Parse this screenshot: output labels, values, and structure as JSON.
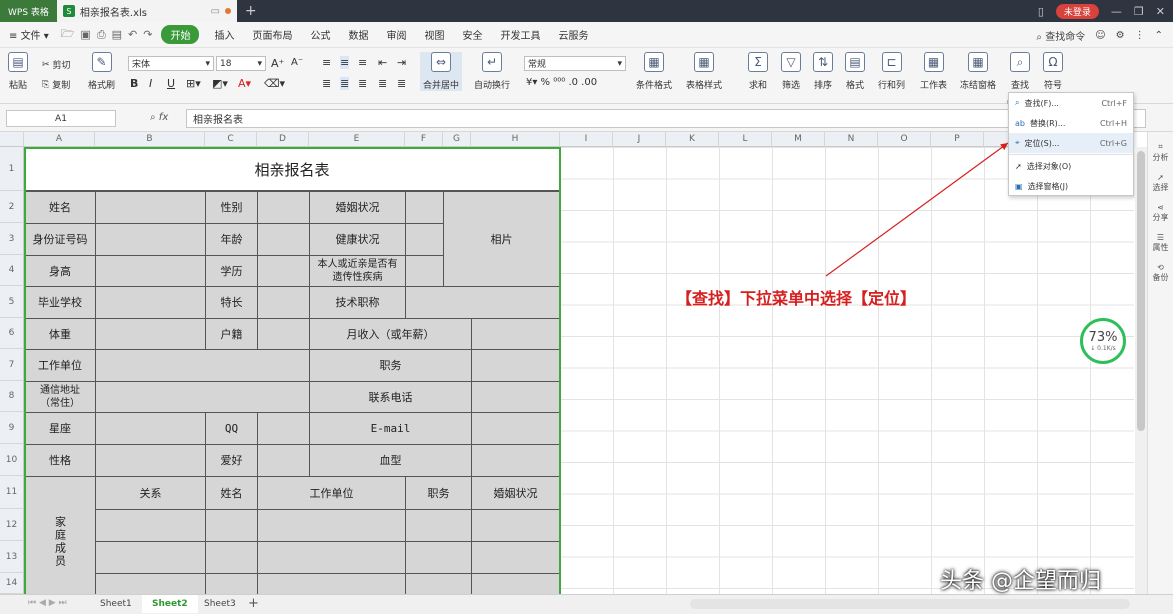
{
  "titlebar": {
    "app": "WPS 表格",
    "doc_tab": "相亲报名表.xls",
    "login": "未登录"
  },
  "menubar": {
    "items": [
      "文件",
      "开始",
      "插入",
      "页面布局",
      "公式",
      "数据",
      "审阅",
      "视图",
      "安全",
      "开发工具",
      "云服务"
    ],
    "search": "查找命令"
  },
  "ribbon": {
    "paste": "粘贴",
    "cut": "剪切",
    "copy": "复制",
    "format_painter": "格式刷",
    "font_name": "宋体",
    "font_size": "18",
    "merge_center": "合并居中",
    "wrap": "自动换行",
    "number_format": "常规",
    "cond_format": "条件格式",
    "table_style": "表格样式",
    "sum": "求和",
    "filter": "筛选",
    "sort": "排序",
    "format": "格式",
    "row_col": "行和列",
    "sheet": "工作表",
    "freeze": "冻结窗格",
    "find": "查找",
    "symbol": "符号"
  },
  "formulabar": {
    "cell": "A1",
    "fx": "fx",
    "value": "相亲报名表"
  },
  "columns": [
    "A",
    "B",
    "C",
    "D",
    "E",
    "F",
    "G",
    "H",
    "I",
    "J",
    "K",
    "L",
    "M",
    "N",
    "O",
    "P"
  ],
  "rows": [
    "1",
    "2",
    "3",
    "4",
    "5",
    "6",
    "7",
    "8",
    "9",
    "10",
    "11",
    "12",
    "13",
    "14"
  ],
  "table": {
    "title": "相亲报名表",
    "r2": [
      "姓名",
      "性别",
      "婚姻状况",
      "相片"
    ],
    "r3": [
      "身份证号码",
      "年龄",
      "健康状况"
    ],
    "r4": [
      "身高",
      "学历",
      "本人或近亲是否有遗传性疾病"
    ],
    "r5": [
      "毕业学校",
      "特长",
      "技术职称"
    ],
    "r6": [
      "体重",
      "户籍",
      "月收入（或年薪）"
    ],
    "r7": [
      "工作单位",
      "职务"
    ],
    "r8": [
      "通信地址（常住）",
      "联系电话"
    ],
    "r9": [
      "星座",
      "QQ",
      "E-mail"
    ],
    "r10": [
      "性格",
      "爱好",
      "血型"
    ],
    "r11": [
      "家庭成员",
      "关系",
      "姓名",
      "工作单位",
      "职务",
      "婚姻状况"
    ]
  },
  "dropdown": {
    "items": [
      {
        "label": "查找(F)...",
        "key": "Ctrl+F"
      },
      {
        "label": "替换(R)...",
        "key": "Ctrl+H"
      },
      {
        "label": "定位(S)...",
        "key": "Ctrl+G"
      },
      {
        "label": "选择对象(O)",
        "key": ""
      },
      {
        "label": "选择窗格(J)",
        "key": ""
      }
    ]
  },
  "annotation": "【查找】下拉菜单中选择【定位】",
  "sidebar": [
    "分析",
    "选择",
    "分享",
    "属性",
    "备份"
  ],
  "speed": {
    "percent": "73%",
    "rate": "0.1K/s"
  },
  "sheets": [
    "Sheet1",
    "Sheet2",
    "Sheet3"
  ],
  "watermark": "头条 @企望而归"
}
